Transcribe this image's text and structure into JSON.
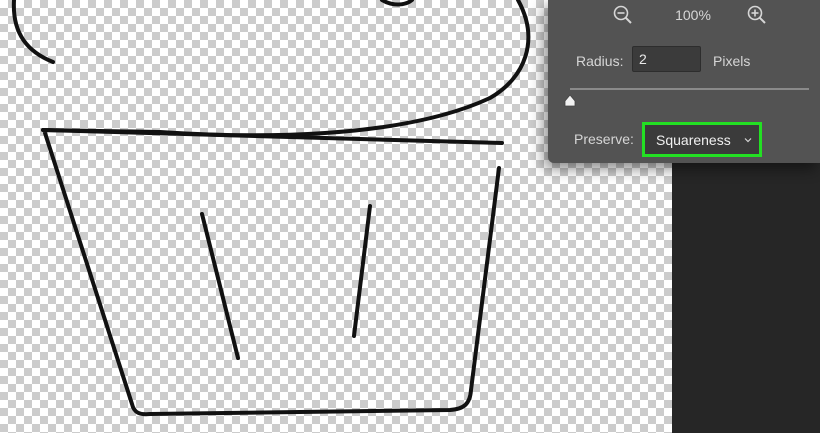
{
  "dialog": {
    "zoom_level": "100%",
    "radius_label": "Radius:",
    "radius_value": "2",
    "radius_unit": "Pixels",
    "slider_value_fraction": 0.0,
    "preserve_label": "Preserve:",
    "preserve_value": "Squareness",
    "highlight_color": "#23e023"
  },
  "icons": {
    "zoom_out": "zoom-out-magnifier-icon",
    "zoom_in": "zoom-in-magnifier-icon",
    "dropdown": "chevron-down-icon"
  }
}
